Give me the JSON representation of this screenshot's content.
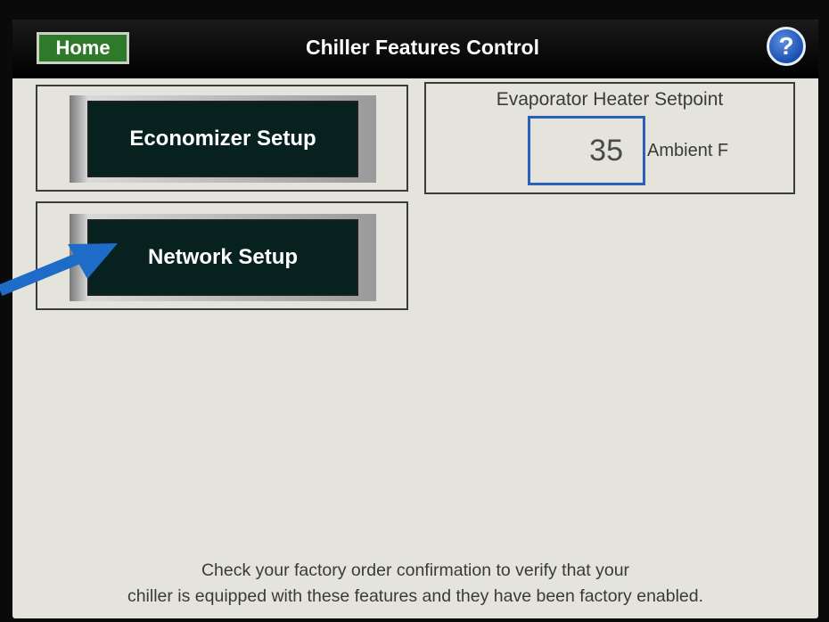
{
  "header": {
    "home_label": "Home",
    "title": "Chiller Features Control",
    "help_label": "?"
  },
  "buttons": {
    "economizer_label": "Economizer Setup",
    "network_label": "Network Setup"
  },
  "evaporator": {
    "title": "Evaporator Heater Setpoint",
    "setpoint_value": "35",
    "unit_label": "Ambient F"
  },
  "footer": {
    "line1": "Check your factory order confirmation to verify that your",
    "line2": "chiller is equipped with these features and they have been factory enabled."
  },
  "colors": {
    "home_button": "#2f7a2a",
    "help_button": "#1a4fb0",
    "button_face": "#07211e",
    "input_border": "#2a60b8",
    "annotation_arrow": "#1e6cc8"
  },
  "annotation": {
    "icon": "blue-arrow-icon"
  }
}
